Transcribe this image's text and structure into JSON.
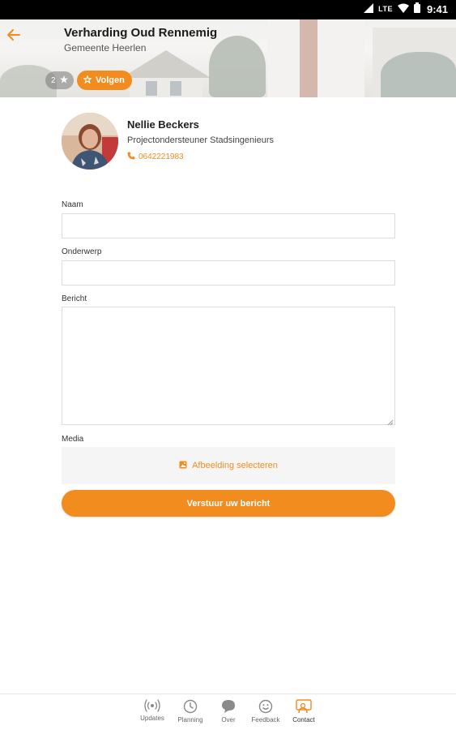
{
  "status_bar": {
    "network": "LTE",
    "time": "9:41"
  },
  "header": {
    "title": "Verharding Oud Rennemig",
    "subtitle": "Gemeente Heerlen",
    "follower_count": "2",
    "follow_label": "Volgen"
  },
  "contact": {
    "name": "Nellie Beckers",
    "role": "Projectondersteuner Stadsingenieurs",
    "phone": "0642221983"
  },
  "form": {
    "name_label": "Naam",
    "name_value": "",
    "subject_label": "Onderwerp",
    "subject_value": "",
    "message_label": "Bericht",
    "message_value": "",
    "media_label": "Media",
    "media_button": "Afbeelding selecteren",
    "submit_label": "Verstuur uw bericht"
  },
  "nav": {
    "items": [
      {
        "label": "Updates",
        "icon": "broadcast-icon"
      },
      {
        "label": "Planning",
        "icon": "clock-icon"
      },
      {
        "label": "Over",
        "icon": "chat-bubble-icon"
      },
      {
        "label": "Feedback",
        "icon": "smiley-icon"
      },
      {
        "label": "Contact",
        "icon": "contact-icon"
      }
    ],
    "active": "Contact"
  },
  "colors": {
    "accent": "#f28c1f",
    "status_bar": "#000000"
  }
}
